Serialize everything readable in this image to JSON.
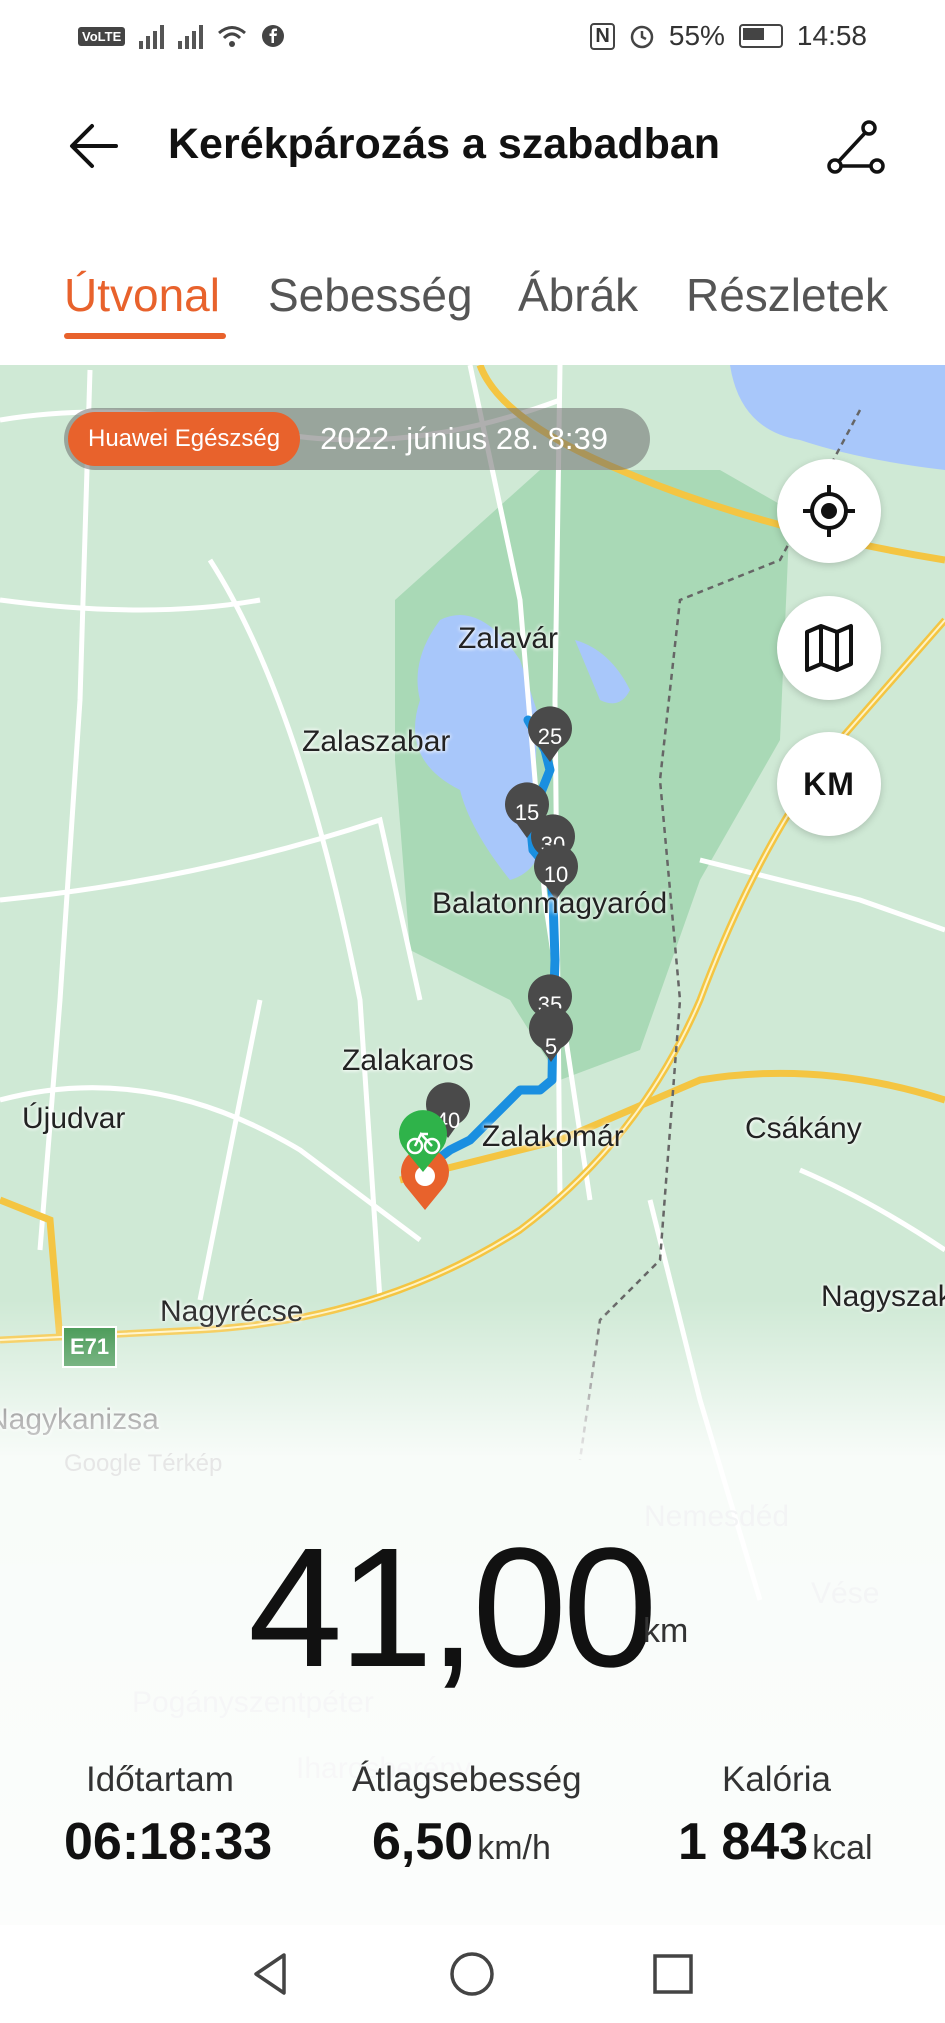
{
  "status_bar": {
    "network": "VoLTE",
    "nfc": "N",
    "battery": "55%",
    "time": "14:58"
  },
  "header": {
    "title": "Kerékpározás a szabadban"
  },
  "tabs": [
    {
      "label": "Útvonal"
    },
    {
      "label": "Sebesség"
    },
    {
      "label": "Ábrák"
    },
    {
      "label": "Részletek"
    }
  ],
  "badge": {
    "brand": "Huawei Egészség",
    "date": "2022. június 28. 8:39"
  },
  "map": {
    "places": [
      "Zalavár",
      "Zalaszabar",
      "Balatonmagyaród",
      "Zalakaros",
      "Zalakomár",
      "Újudvar",
      "Csákány",
      "Nagyrécse",
      "Nagyszakácsi",
      "Nagykanizsa",
      "Nemesdéd",
      "Vése",
      "Pogányszentpéter",
      "Iharosberény"
    ],
    "road_shield": "E71",
    "attribution": "Google Térkép",
    "km_markers": [
      "25",
      "15",
      "30",
      "10",
      "35",
      "5",
      "40"
    ],
    "unit_toggle": "KM"
  },
  "summary": {
    "distance": "41,00",
    "distance_unit": "km",
    "duration_label": "Időtartam",
    "duration": "06:18:33",
    "speed_label": "Átlagsebesség",
    "speed": "6,50",
    "speed_unit": "km/h",
    "calories_label": "Kalória",
    "calories": "1 843",
    "calories_unit": "kcal"
  },
  "colors": {
    "accent": "#e8622c",
    "route": "#1a8fe0",
    "map_green": "#cfe9d5",
    "water": "#a8c7fa"
  }
}
